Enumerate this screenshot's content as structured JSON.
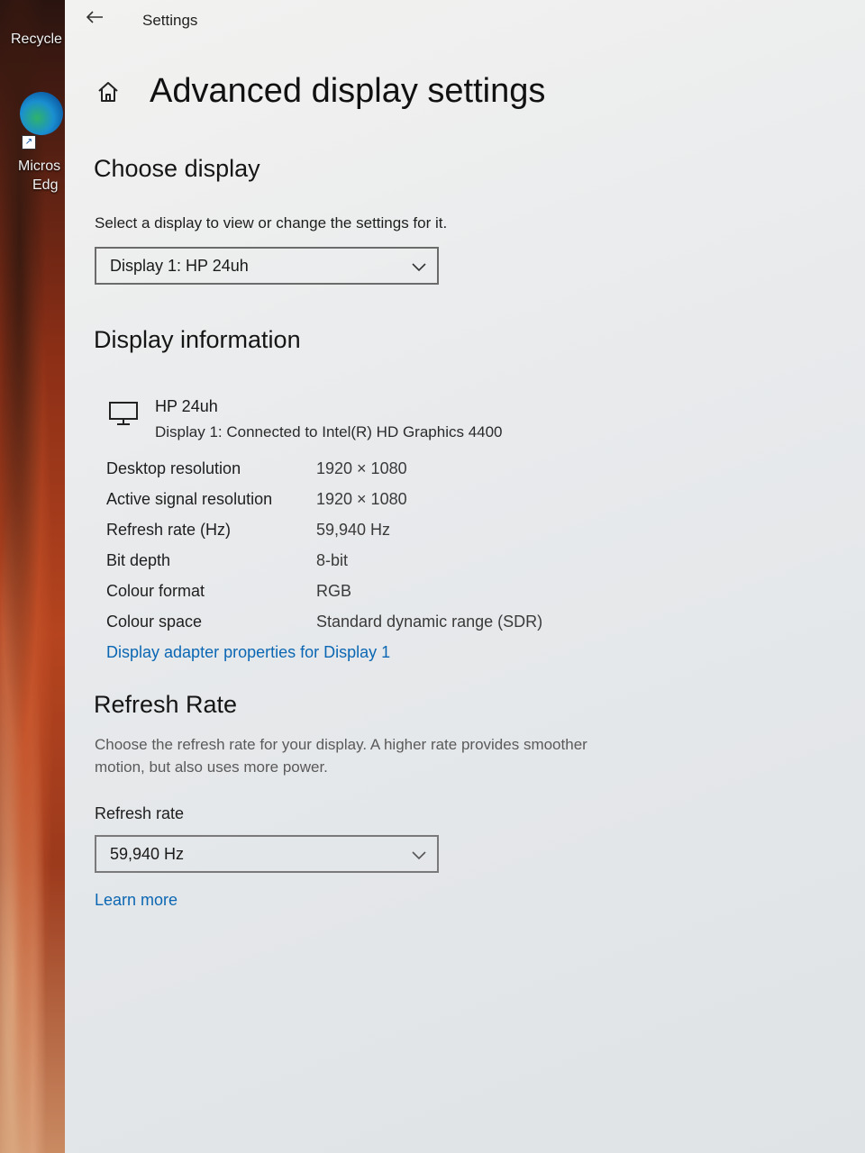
{
  "desktop": {
    "icons": [
      {
        "label": "Recycle"
      },
      {
        "label": "Micros",
        "label2": "Edg"
      }
    ]
  },
  "window": {
    "back_icon": "back-arrow-icon",
    "title": "Settings"
  },
  "page": {
    "home_icon": "home-icon",
    "title": "Advanced display settings"
  },
  "choose_display": {
    "heading": "Choose display",
    "instruction": "Select a display to view or change the settings for it.",
    "selected": "Display 1: HP 24uh"
  },
  "display_information": {
    "heading": "Display information",
    "monitor_icon": "monitor-icon",
    "monitor_name": "HP 24uh",
    "monitor_connection": "Display 1: Connected to Intel(R) HD Graphics 4400",
    "rows": [
      {
        "label": "Desktop resolution",
        "value": "1920 × 1080"
      },
      {
        "label": "Active signal resolution",
        "value": "1920 × 1080"
      },
      {
        "label": "Refresh rate (Hz)",
        "value": "59,940 Hz"
      },
      {
        "label": "Bit depth",
        "value": "8-bit"
      },
      {
        "label": "Colour format",
        "value": "RGB"
      },
      {
        "label": "Colour space",
        "value": "Standard dynamic range (SDR)"
      }
    ],
    "adapter_link": "Display adapter properties for Display 1"
  },
  "refresh_rate": {
    "heading": "Refresh Rate",
    "description": "Choose the refresh rate for your display. A higher rate provides smoother motion, but also uses more power.",
    "field_label": "Refresh rate",
    "selected": "59,940 Hz",
    "learn_more": "Learn more"
  },
  "colors": {
    "link": "#0b67b3",
    "window_bg": "#eceeef"
  }
}
